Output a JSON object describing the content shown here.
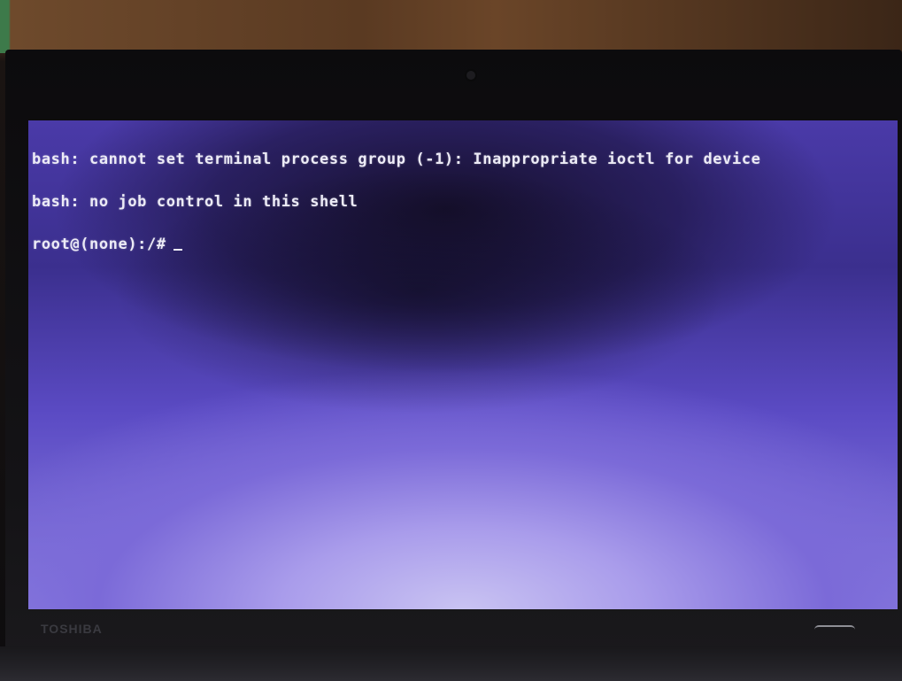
{
  "terminal": {
    "lines": [
      "bash: cannot set terminal process group (-1): Inappropriate ioctl for device",
      "bash: no job control in this shell"
    ],
    "prompt": "root@(none):/#",
    "input": ""
  },
  "laptop": {
    "brand": "TOSHIBA"
  },
  "colors": {
    "screen_blue": "#5b4bc4",
    "text": "#ecebf6",
    "bezel": "#0c0b0d"
  }
}
